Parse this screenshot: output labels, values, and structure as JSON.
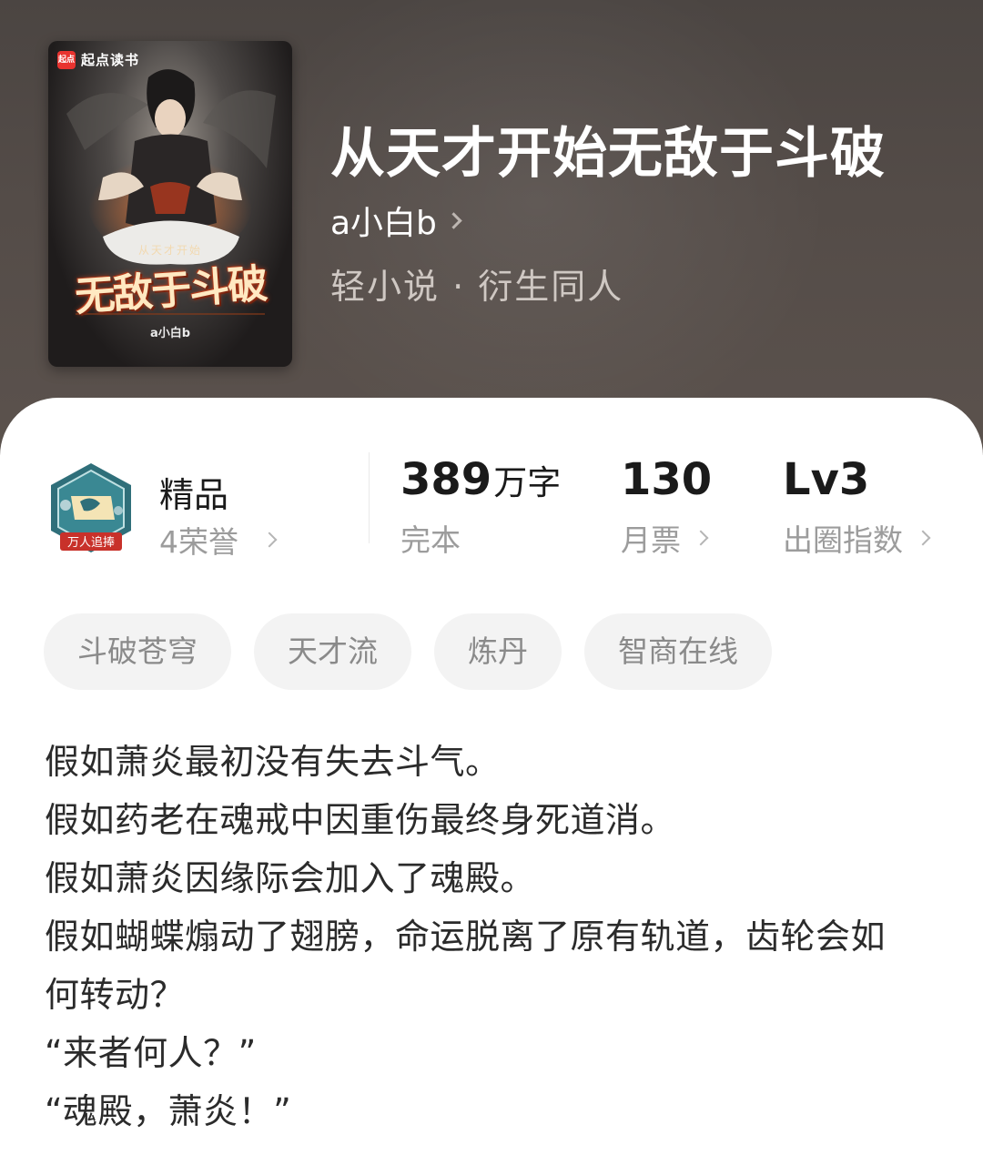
{
  "cover": {
    "brand": "起点读书",
    "brand_logo": "起点",
    "subtitle": "从天才开始",
    "title": "无敌于斗破",
    "author": "a小白b"
  },
  "book": {
    "title": "从天才开始无敌于斗破",
    "author": "a小白b",
    "genre": "轻小说 · 衍生同人"
  },
  "honor": {
    "badge_text": "万人追捧",
    "title": "精品",
    "subtitle": "4荣誉"
  },
  "stats": {
    "words": {
      "value": "389",
      "unit": "万字",
      "label": "完本"
    },
    "tickets": {
      "value": "130",
      "label": "月票"
    },
    "index": {
      "value": "Lv3",
      "label": "出圈指数"
    }
  },
  "tags": [
    "斗破苍穹",
    "天才流",
    "炼丹",
    "智商在线"
  ],
  "synopsis": [
    "假如萧炎最初没有失去斗气。",
    "假如药老在魂戒中因重伤最终身死道消。",
    "假如萧炎因缘际会加入了魂殿。",
    "假如蝴蝶煽动了翅膀，命运脱离了原有轨道，齿轮会如何转动？",
    "“来者何人？”",
    "“魂殿，萧炎！”"
  ],
  "colors": {
    "header_bg": "#4f4845",
    "brand_red": "#e8332f",
    "badge_teal": "#2f6f7a",
    "badge_ribbon": "#c8312a"
  }
}
